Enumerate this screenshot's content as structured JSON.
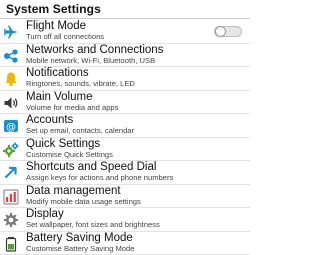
{
  "header": {
    "title": "System Settings"
  },
  "items": [
    {
      "icon": "airplane-icon",
      "title": "Flight Mode",
      "subtitle": "Turn off all connections",
      "toggle": {
        "state": "off"
      }
    },
    {
      "icon": "network-icon",
      "title": "Networks and Connections",
      "subtitle": "Mobile network, Wi-Fi, Bluetooth, USB"
    },
    {
      "icon": "bell-icon",
      "title": "Notifications",
      "subtitle": "Ringtones, sounds, vibrate, LED"
    },
    {
      "icon": "speaker-icon",
      "title": "Main Volume",
      "subtitle": "Volume for media and apps"
    },
    {
      "icon": "at-sign-icon",
      "title": "Accounts",
      "subtitle": "Set up email, contacts, calendar"
    },
    {
      "icon": "gear-icon",
      "title": "Quick Settings",
      "subtitle": "Customise Quick Settings"
    },
    {
      "icon": "keyboard-shortcut-icon",
      "title": "Shortcuts and Speed Dial",
      "subtitle": "Assign keys for actions and phone numbers"
    },
    {
      "icon": "data-chart-icon",
      "title": "Data management",
      "subtitle": "Modify mobile data usage settings"
    },
    {
      "icon": "display-gear-icon",
      "title": "Display",
      "subtitle": "Set wallpaper, font sizes and brightness"
    },
    {
      "icon": "battery-icon",
      "title": "Battery Saving Mode",
      "subtitle": "Customise Battery Saving Mode"
    }
  ],
  "colors": {
    "accent": "#1a8fd0",
    "bell": "#f2b705",
    "data": "#e23c3c",
    "gear_green": "#5aa02c"
  }
}
